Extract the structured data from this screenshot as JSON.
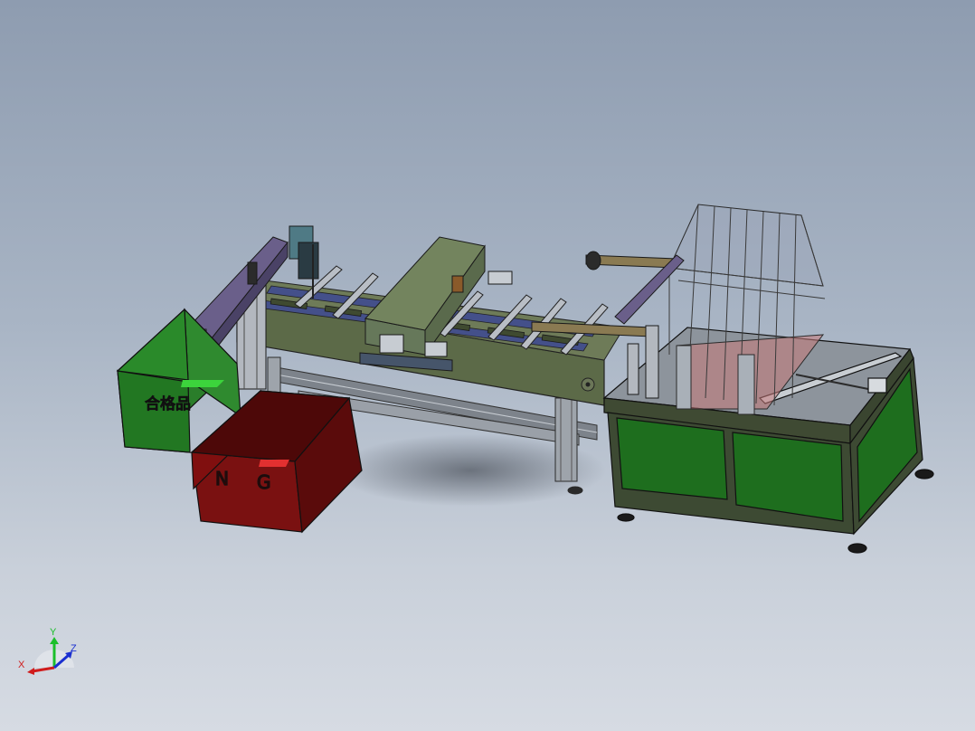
{
  "scene": {
    "bins": {
      "pass": {
        "label": "合格品",
        "color": "#1f7a1f"
      },
      "ng": {
        "label_n": "N",
        "label_g": "G",
        "color": "#7a0d0d"
      }
    },
    "frame_color": "#3d4a33",
    "panel_color": "#1e6e1e",
    "conveyor_color": "#5a6648",
    "rail_color": "#8a8f96"
  },
  "triad": {
    "x": "X",
    "y": "Y",
    "z": "Z",
    "x_color": "#d01c1c",
    "y_color": "#1bbf2a",
    "z_color": "#1a2fd0"
  }
}
